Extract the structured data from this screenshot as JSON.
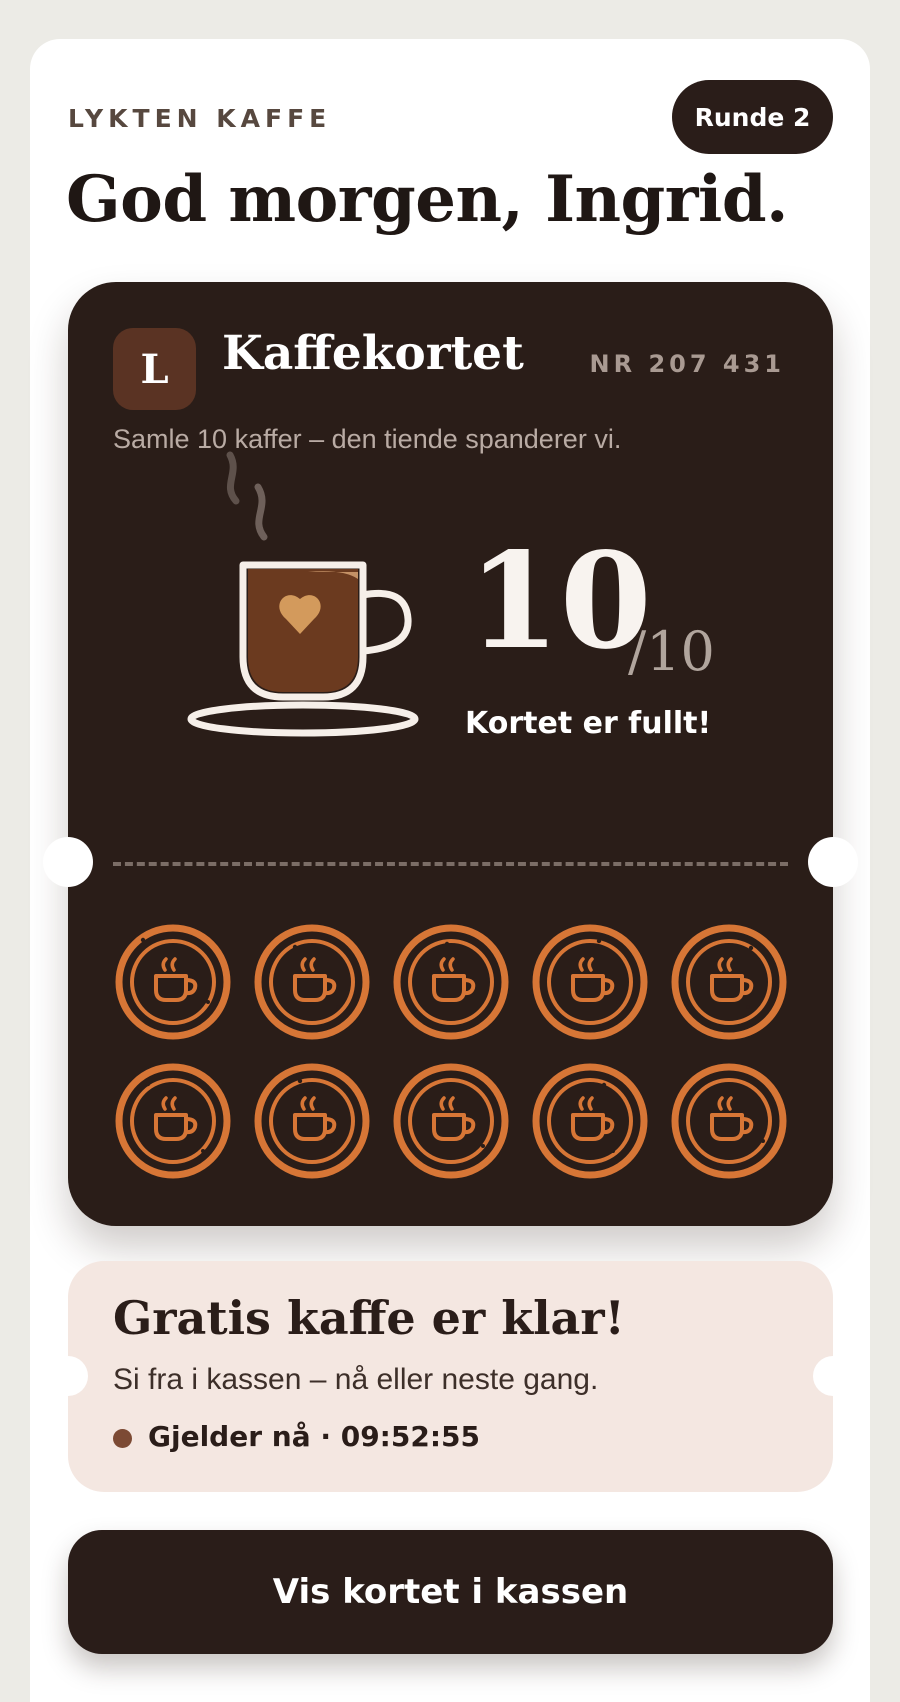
{
  "header": {
    "brand": "LYKTEN KAFFE",
    "round_label": "Runde 2",
    "greeting": "God morgen, Ingrid."
  },
  "card": {
    "logo_letter": "L",
    "title": "Kaffekortet",
    "number": "NR 207 431",
    "subtitle": "Samle 10 kaffer – den tiende spanderer vi.",
    "count": "10",
    "total": "/10",
    "status": "Kortet er fullt!",
    "stamps_collected": 10,
    "stamps_total": 10
  },
  "reward": {
    "title": "Gratis kaffe er klar!",
    "subtitle": "Si fra i kassen – nå eller neste gang.",
    "valid": "Gjelder nå · 09:52:55"
  },
  "actions": {
    "show_card": "Vis kortet i kassen"
  },
  "colors": {
    "card_bg": "#2a1d18",
    "stamp": "#d77636",
    "coffee": "#6b3a1f",
    "heart": "#d39a5c",
    "reward_bg": "#f4e7e1"
  }
}
